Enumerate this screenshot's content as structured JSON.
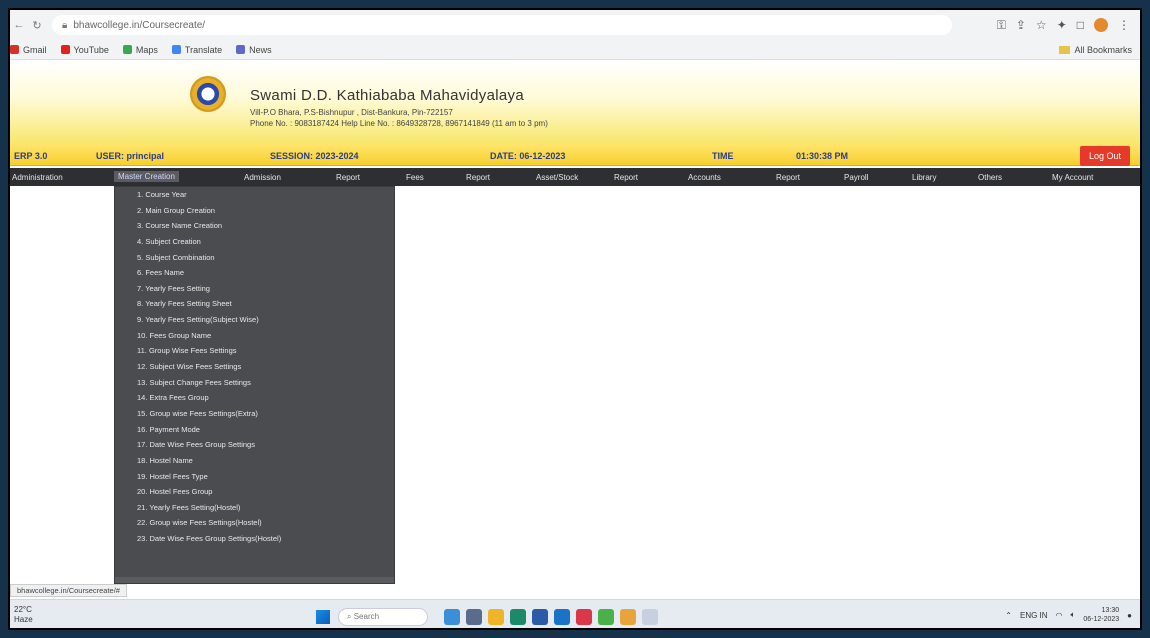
{
  "browser": {
    "url": "bhawcollege.in/Coursecreate/",
    "bookmarks": [
      "Gmail",
      "YouTube",
      "Maps",
      "Translate",
      "News"
    ],
    "all_bookmarks": "All Bookmarks"
  },
  "header": {
    "college_name": "Swami D.D. Kathiababa Mahavidyalaya",
    "address": "Vill-P.O Bhara, P.S-Bishnupur , Dist-Bankura, Pin-722157",
    "phone": "Phone No. : 9083187424  Help Line No. : 8649328728, 8967141849 (11 am to 3 pm)"
  },
  "info_bar": {
    "version": "ERP 3.0",
    "user": "USER: principal",
    "session": "SESSION: 2023-2024",
    "date": "DATE: 06-12-2023",
    "time_label": "TIME",
    "time_value": "01:30:38 PM",
    "logout_label": "Log Out"
  },
  "menu": [
    "Administration",
    "Master Creation",
    "Admission",
    "Report",
    "Fees",
    "Report",
    "Asset/Stock",
    "Report",
    "Accounts",
    "Report",
    "Payroll",
    "Library",
    "Others",
    "My Account"
  ],
  "dropdown_items": [
    "1. Course Year",
    "2. Main Group Creation",
    "3. Course Name Creation",
    "4. Subject Creation",
    "5. Subject Combination",
    "6. Fees Name",
    "7. Yearly Fees Setting",
    "8. Yearly Fees Setting Sheet",
    "9. Yearly Fees Setting(Subject Wise)",
    "10. Fees Group Name",
    "11. Group Wise Fees Settings",
    "12. Subject Wise Fees Settings",
    "13. Subject Change Fees Settings",
    "14. Extra Fees Group",
    "15. Group wise Fees Settings(Extra)",
    "16. Payment Mode",
    "17. Date Wise Fees Group Settings",
    "18. Hostel Name",
    "19. Hostel Fees Type",
    "20. Hostel Fees Group",
    "21. Yearly Fees Setting(Hostel)",
    "22. Group wise Fees Settings(Hostel)",
    "23. Date Wise Fees Group Settings(Hostel)"
  ],
  "status_url": "bhawcollege.in/Coursecreate/#",
  "taskbar": {
    "weather_temp": "22°C",
    "weather_desc": "Haze",
    "search_placeholder": "Search",
    "lang": "ENG IN",
    "time": "13:30",
    "date": "06-12-2023"
  },
  "colors": {
    "menu_bg": "#2d2f33",
    "dropdown_bg": "#4b4c4f",
    "info_bar": "#f6cf2e",
    "logout": "#e53a2a"
  }
}
